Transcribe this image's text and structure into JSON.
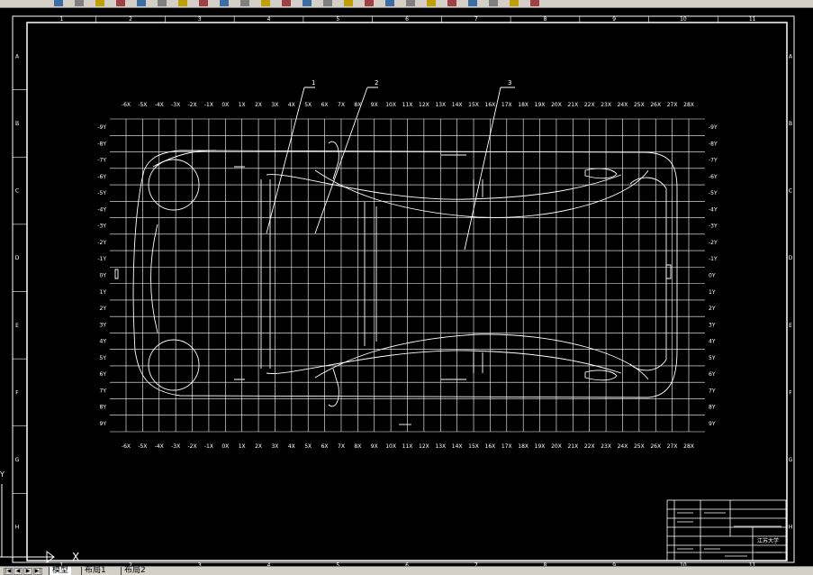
{
  "toolbar": {
    "icons": [
      "open-icon",
      "save-icon",
      "print-icon",
      "preview-icon",
      "cut-icon",
      "copy-icon",
      "paste-icon",
      "match-icon",
      "undo-icon",
      "redo-icon",
      "pan-icon",
      "zoom-realtime-icon",
      "zoom-window-icon",
      "zoom-previous-icon",
      "properties-icon",
      "design-center-icon",
      "tool-palette-icon",
      "sheet-set-icon",
      "markup-icon",
      "calculator-icon",
      "help-icon",
      "layer-icon",
      "layer-state-icon",
      "color-icon"
    ]
  },
  "drawing": {
    "frame_cols": [
      "1",
      "2",
      "3",
      "4",
      "5",
      "6",
      "7",
      "8",
      "9",
      "10",
      "11"
    ],
    "frame_rows": [
      "A",
      "B",
      "C",
      "D",
      "E",
      "F",
      "G",
      "H"
    ],
    "x_ticks": [
      "-6X",
      "-5X",
      "-4X",
      "-3X",
      "-2X",
      "-1X",
      "0X",
      "1X",
      "2X",
      "3X",
      "4X",
      "5X",
      "6X",
      "7X",
      "8X",
      "9X",
      "10X",
      "11X",
      "12X",
      "13X",
      "14X",
      "15X",
      "16X",
      "17X",
      "18X",
      "19X",
      "20X",
      "21X",
      "22X",
      "23X",
      "24X",
      "25X",
      "26X",
      "27X",
      "28X"
    ],
    "y_ticks": [
      "-9Y",
      "-8Y",
      "-7Y",
      "-6Y",
      "-5Y",
      "-4Y",
      "-3Y",
      "-2Y",
      "-1Y",
      "0Y",
      "1Y",
      "2Y",
      "3Y",
      "4Y",
      "5Y",
      "6Y",
      "7Y",
      "8Y",
      "9Y"
    ],
    "callouts": [
      "1",
      "2",
      "3"
    ],
    "title_block": {
      "org": "江苏大学"
    }
  },
  "ucs": {
    "x_label": "X",
    "y_label": "Y"
  },
  "layout_tabs": {
    "nav": [
      "|◀",
      "◀",
      "▶",
      "▶|"
    ],
    "tabs": [
      {
        "label": "模型",
        "active": true
      },
      {
        "label": "布局1",
        "active": false
      },
      {
        "label": "布局2",
        "active": false
      }
    ]
  }
}
